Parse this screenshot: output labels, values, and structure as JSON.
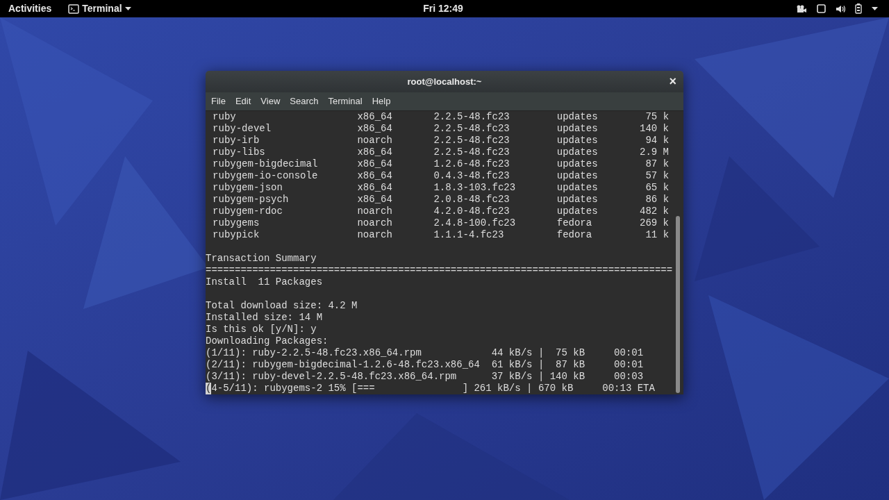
{
  "top_bar": {
    "activities": "Activities",
    "app_menu": "Terminal",
    "clock": "Fri 12:49"
  },
  "window": {
    "title": "root@localhost:~",
    "close": "×",
    "menu": [
      "File",
      "Edit",
      "View",
      "Search",
      "Terminal",
      "Help"
    ]
  },
  "terminal": {
    "package_rows": [
      {
        "name": "ruby",
        "arch": "x86_64",
        "version": "2.2.5-48.fc23",
        "repo": "updates",
        "size": "75 k"
      },
      {
        "name": "ruby-devel",
        "arch": "x86_64",
        "version": "2.2.5-48.fc23",
        "repo": "updates",
        "size": "140 k"
      },
      {
        "name": "ruby-irb",
        "arch": "noarch",
        "version": "2.2.5-48.fc23",
        "repo": "updates",
        "size": "94 k"
      },
      {
        "name": "ruby-libs",
        "arch": "x86_64",
        "version": "2.2.5-48.fc23",
        "repo": "updates",
        "size": "2.9 M"
      },
      {
        "name": "rubygem-bigdecimal",
        "arch": "x86_64",
        "version": "1.2.6-48.fc23",
        "repo": "updates",
        "size": "87 k"
      },
      {
        "name": "rubygem-io-console",
        "arch": "x86_64",
        "version": "0.4.3-48.fc23",
        "repo": "updates",
        "size": "57 k"
      },
      {
        "name": "rubygem-json",
        "arch": "x86_64",
        "version": "1.8.3-103.fc23",
        "repo": "updates",
        "size": "65 k"
      },
      {
        "name": "rubygem-psych",
        "arch": "x86_64",
        "version": "2.0.8-48.fc23",
        "repo": "updates",
        "size": "86 k"
      },
      {
        "name": "rubygem-rdoc",
        "arch": "noarch",
        "version": "4.2.0-48.fc23",
        "repo": "updates",
        "size": "482 k"
      },
      {
        "name": "rubygems",
        "arch": "noarch",
        "version": "2.4.8-100.fc23",
        "repo": "fedora",
        "size": "269 k"
      },
      {
        "name": "rubypick",
        "arch": "noarch",
        "version": "1.1.1-4.fc23",
        "repo": "fedora",
        "size": "11 k"
      }
    ],
    "lines": [
      {
        "kind": "blank",
        "cursor": false
      },
      {
        "kind": "text",
        "text": "Transaction Summary",
        "cursor": false
      },
      {
        "kind": "text",
        "text": "================================================================================",
        "cursor": false
      },
      {
        "kind": "text",
        "text": "Install  11 Packages",
        "cursor": false
      },
      {
        "kind": "blank",
        "cursor": false
      },
      {
        "kind": "text",
        "text": "Total download size: 4.2 M",
        "cursor": false
      },
      {
        "kind": "text",
        "text": "Installed size: 14 M",
        "cursor": false
      },
      {
        "kind": "text",
        "text": "Is this ok [y/N]: y",
        "cursor": false
      },
      {
        "kind": "text",
        "text": "Downloading Packages:",
        "cursor": false
      },
      {
        "kind": "text",
        "text": "(1/11): ruby-2.2.5-48.fc23.x86_64.rpm            44 kB/s |  75 kB     00:01",
        "cursor": false
      },
      {
        "kind": "text",
        "text": "(2/11): rubygem-bigdecimal-1.2.6-48.fc23.x86_64  61 kB/s |  87 kB     00:01",
        "cursor": false
      },
      {
        "kind": "text",
        "text": "(3/11): ruby-devel-2.2.5-48.fc23.x86_64.rpm      37 kB/s | 140 kB     00:03",
        "cursor": false
      },
      {
        "kind": "text",
        "text": "(4-5/11): rubygems-2 15% [===               ] 261 kB/s | 670 kB     00:13 ETA",
        "cursor": true
      }
    ]
  }
}
